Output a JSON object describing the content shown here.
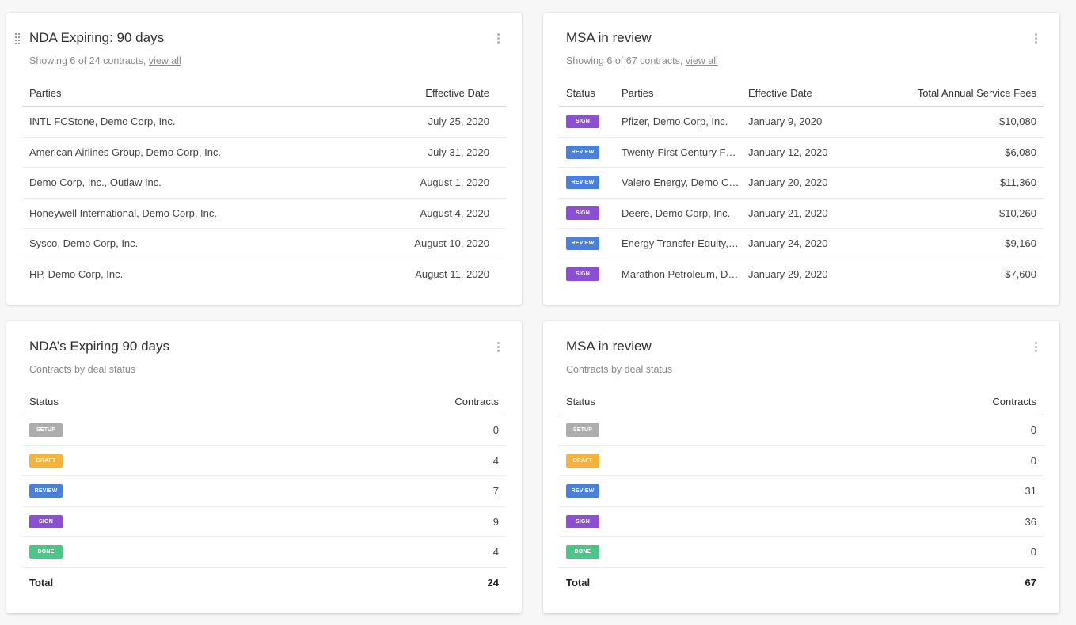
{
  "colors": {
    "setup": "#adadad",
    "draft": "#f3b33d",
    "review": "#4a80dc",
    "sign": "#8a4fd2",
    "done": "#4cc687"
  },
  "cards": [
    {
      "title": "NDA Expiring: 90 days",
      "subtitle_prefix": "Showing 6 of 24 contracts,",
      "subtitle_link": "view all",
      "headers": {
        "parties": "Parties",
        "effective_date": "Effective Date"
      },
      "rows": [
        {
          "parties": "INTL FCStone, Demo Corp, Inc.",
          "date": "July 25, 2020"
        },
        {
          "parties": "American Airlines Group, Demo Corp, Inc.",
          "date": "July 31, 2020"
        },
        {
          "parties": "Demo Corp, Inc., Outlaw Inc.",
          "date": "August 1, 2020"
        },
        {
          "parties": "Honeywell International, Demo Corp, Inc.",
          "date": "August 4, 2020"
        },
        {
          "parties": "Sysco, Demo Corp, Inc.",
          "date": "August 10, 2020"
        },
        {
          "parties": "HP, Demo Corp, Inc.",
          "date": "August 11, 2020"
        }
      ]
    },
    {
      "title": "MSA in review",
      "subtitle_prefix": "Showing 6 of 67 contracts,",
      "subtitle_link": "view all",
      "headers": {
        "status": "Status",
        "parties": "Parties",
        "effective_date": "Effective Date",
        "fees": "Total Annual Service Fees"
      },
      "rows": [
        {
          "status": "SIGN",
          "parties": "Pfizer, Demo Corp, Inc.",
          "date": "January 9, 2020",
          "fees": "$10,080"
        },
        {
          "status": "REVIEW",
          "parties": "Twenty-First Century Fox, Demo Corp, Inc.",
          "date": "January 12, 2020",
          "fees": "$6,080"
        },
        {
          "status": "REVIEW",
          "parties": "Valero Energy, Demo Corp, Inc.",
          "date": "January 20, 2020",
          "fees": "$11,360"
        },
        {
          "status": "SIGN",
          "parties": "Deere, Demo Corp, Inc.",
          "date": "January 21, 2020",
          "fees": "$10,260"
        },
        {
          "status": "REVIEW",
          "parties": "Energy Transfer Equity, Demo Corp, Inc.",
          "date": "January 24, 2020",
          "fees": "$9,160"
        },
        {
          "status": "SIGN",
          "parties": "Marathon Petroleum, Demo Corp, Inc.",
          "date": "January 29, 2020",
          "fees": "$7,600"
        }
      ]
    },
    {
      "title": "NDA’s Expiring 90 days",
      "subtitle": "Contracts by deal status",
      "headers": {
        "status": "Status",
        "contracts": "Contracts"
      },
      "rows": [
        {
          "status": "SETUP",
          "count": "0"
        },
        {
          "status": "DRAFT",
          "count": "4"
        },
        {
          "status": "REVIEW",
          "count": "7"
        },
        {
          "status": "SIGN",
          "count": "9"
        },
        {
          "status": "DONE",
          "count": "4"
        }
      ],
      "total_label": "Total",
      "total": "24"
    },
    {
      "title": "MSA in review",
      "subtitle": "Contracts by deal status",
      "headers": {
        "status": "Status",
        "contracts": "Contracts"
      },
      "rows": [
        {
          "status": "SETUP",
          "count": "0"
        },
        {
          "status": "DRAFT",
          "count": "0"
        },
        {
          "status": "REVIEW",
          "count": "31"
        },
        {
          "status": "SIGN",
          "count": "36"
        },
        {
          "status": "DONE",
          "count": "0"
        }
      ],
      "total_label": "Total",
      "total": "67"
    }
  ]
}
